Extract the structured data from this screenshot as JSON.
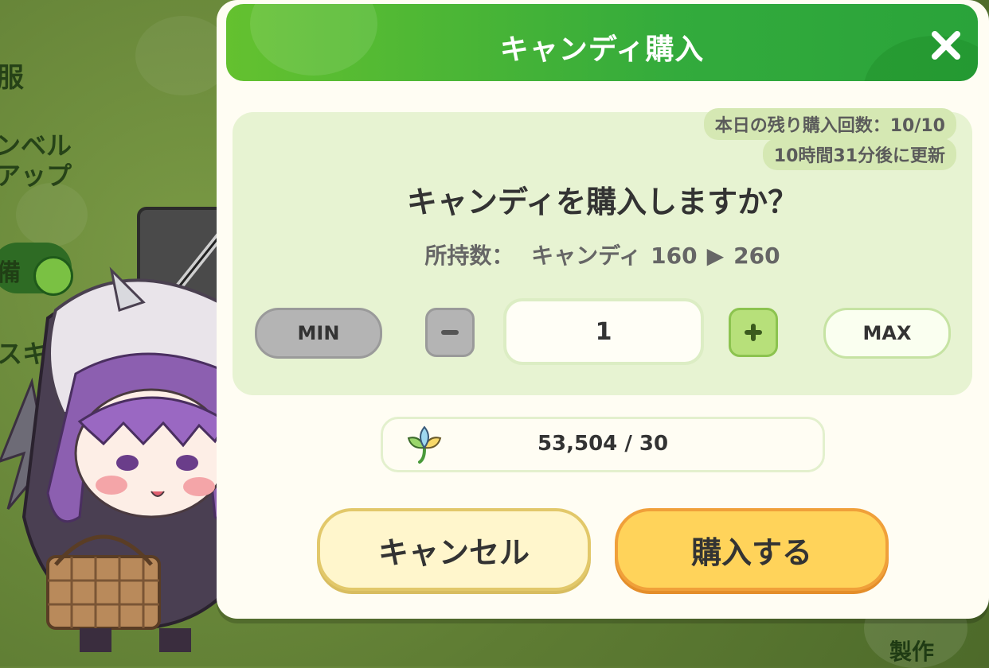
{
  "background": {
    "side_labels": [
      "服",
      "ンベル",
      "アップ",
      "備",
      "スキル"
    ],
    "craft_label": "製作"
  },
  "dialog": {
    "title": "キャンディ購入",
    "remaining_purchases": "本日の残り購入回数：10/10",
    "refresh_time": "10時間31分後に更新",
    "question": "キャンディを購入しますか？",
    "owned": {
      "label": "所持数：",
      "item_name": "キャンディ",
      "current": "160",
      "arrow": "▶",
      "after": "260"
    },
    "quantity": {
      "min_label": "MIN",
      "max_label": "MAX",
      "value": "1"
    },
    "cost": {
      "text": "53,504 / 30",
      "icon": "crystal-leaf-icon"
    },
    "cancel_label": "キャンセル",
    "buy_label": "購入する"
  },
  "colors": {
    "header_green": "#33ab3c",
    "buy_button": "#ffd35a",
    "cancel_button": "#fff6cc",
    "panel_bg": "#e7f3d2"
  }
}
